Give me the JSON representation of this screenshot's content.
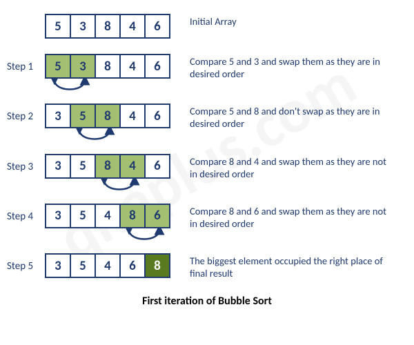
{
  "initial_label": "Initial Array",
  "caption": "First iteration of Bubble Sort",
  "watermark": "qnaplus.com",
  "rows": [
    {
      "step": "",
      "cells": [
        "5",
        "3",
        "8",
        "4",
        "6"
      ],
      "hl": [],
      "final": [],
      "swap_at": null,
      "desc": "Initial Array"
    },
    {
      "step": "Step 1",
      "cells": [
        "5",
        "3",
        "8",
        "4",
        "6"
      ],
      "hl": [
        0,
        1
      ],
      "final": [],
      "swap_at": 0,
      "desc": "Compare 5 and 3 and swap them as they are in desired order"
    },
    {
      "step": "Step 2",
      "cells": [
        "3",
        "5",
        "8",
        "4",
        "6"
      ],
      "hl": [
        1,
        2
      ],
      "final": [],
      "swap_at": 1,
      "desc": "Compare 5 and 8 and don't swap as they are in desired order"
    },
    {
      "step": "Step 3",
      "cells": [
        "3",
        "5",
        "8",
        "4",
        "6"
      ],
      "hl": [
        2,
        3
      ],
      "final": [],
      "swap_at": 2,
      "desc": "Compare 8 and 4 and swap them as they are not in desired order"
    },
    {
      "step": "Step 4",
      "cells": [
        "3",
        "5",
        "4",
        "8",
        "6"
      ],
      "hl": [
        3,
        4
      ],
      "final": [],
      "swap_at": 3,
      "desc": "Compare 8 and 6 and swap them as they are not in desired order"
    },
    {
      "step": "Step 5",
      "cells": [
        "3",
        "5",
        "4",
        "6",
        "8"
      ],
      "hl": [],
      "final": [
        4
      ],
      "swap_at": null,
      "desc": "The biggest element occupied the right place of final result"
    }
  ],
  "chart_data": {
    "type": "table",
    "title": "First iteration of Bubble Sort",
    "columns": [
      "step",
      "array_state",
      "highlighted_indices",
      "final_indices",
      "description"
    ],
    "rows": [
      [
        "Initial",
        [
          5,
          3,
          8,
          4,
          6
        ],
        [],
        [],
        "Initial Array"
      ],
      [
        "Step 1",
        [
          5,
          3,
          8,
          4,
          6
        ],
        [
          0,
          1
        ],
        [],
        "Compare 5 and 3 and swap them as they are in desired order"
      ],
      [
        "Step 2",
        [
          3,
          5,
          8,
          4,
          6
        ],
        [
          1,
          2
        ],
        [],
        "Compare 5 and 8 and don't swap as they are in desired order"
      ],
      [
        "Step 3",
        [
          3,
          5,
          8,
          4,
          6
        ],
        [
          2,
          3
        ],
        [],
        "Compare 8 and 4 and swap them as they are not in desired order"
      ],
      [
        "Step 4",
        [
          3,
          5,
          4,
          8,
          6
        ],
        [
          3,
          4
        ],
        [],
        "Compare 8 and 6 and swap them as they are not in desired order"
      ],
      [
        "Step 5",
        [
          3,
          5,
          4,
          6,
          8
        ],
        [],
        [
          4
        ],
        "The biggest element occupied the right place of final result"
      ]
    ]
  }
}
